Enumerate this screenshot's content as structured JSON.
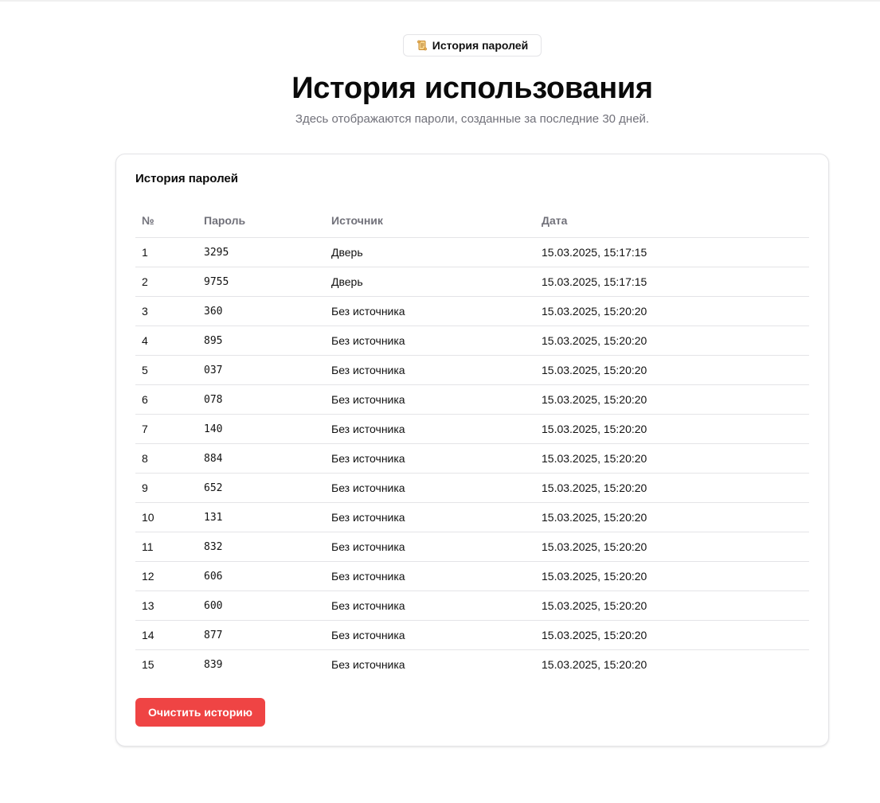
{
  "badge": {
    "icon": "scroll-icon",
    "label": "История паролей"
  },
  "header": {
    "title": "История использования",
    "subtitle": "Здесь отображаются пароли, созданные за последние 30 дней."
  },
  "card": {
    "title": "История паролей",
    "columns": [
      "№",
      "Пароль",
      "Источник",
      "Дата"
    ],
    "rows": [
      {
        "num": "1",
        "password": "3295",
        "source": "Дверь",
        "date": "15.03.2025, 15:17:15"
      },
      {
        "num": "2",
        "password": "9755",
        "source": "Дверь",
        "date": "15.03.2025, 15:17:15"
      },
      {
        "num": "3",
        "password": "360",
        "source": "Без источника",
        "date": "15.03.2025, 15:20:20"
      },
      {
        "num": "4",
        "password": "895",
        "source": "Без источника",
        "date": "15.03.2025, 15:20:20"
      },
      {
        "num": "5",
        "password": "037",
        "source": "Без источника",
        "date": "15.03.2025, 15:20:20"
      },
      {
        "num": "6",
        "password": "078",
        "source": "Без источника",
        "date": "15.03.2025, 15:20:20"
      },
      {
        "num": "7",
        "password": "140",
        "source": "Без источника",
        "date": "15.03.2025, 15:20:20"
      },
      {
        "num": "8",
        "password": "884",
        "source": "Без источника",
        "date": "15.03.2025, 15:20:20"
      },
      {
        "num": "9",
        "password": "652",
        "source": "Без источника",
        "date": "15.03.2025, 15:20:20"
      },
      {
        "num": "10",
        "password": "131",
        "source": "Без источника",
        "date": "15.03.2025, 15:20:20"
      },
      {
        "num": "11",
        "password": "832",
        "source": "Без источника",
        "date": "15.03.2025, 15:20:20"
      },
      {
        "num": "12",
        "password": "606",
        "source": "Без источника",
        "date": "15.03.2025, 15:20:20"
      },
      {
        "num": "13",
        "password": "600",
        "source": "Без источника",
        "date": "15.03.2025, 15:20:20"
      },
      {
        "num": "14",
        "password": "877",
        "source": "Без источника",
        "date": "15.03.2025, 15:20:20"
      },
      {
        "num": "15",
        "password": "839",
        "source": "Без источника",
        "date": "15.03.2025, 15:20:20"
      }
    ],
    "clear_button": "Очистить историю"
  },
  "colors": {
    "danger": "#ef4444",
    "muted_text": "#71717a",
    "border": "#e4e4e7"
  }
}
